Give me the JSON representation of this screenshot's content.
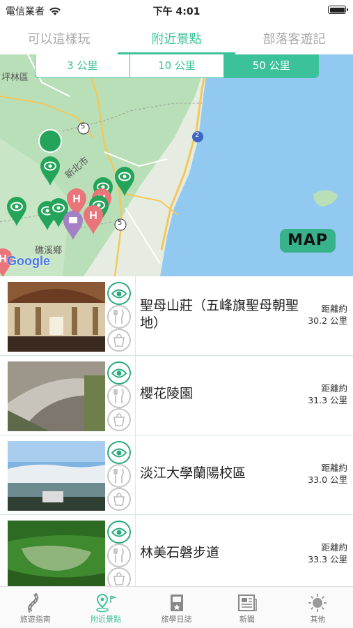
{
  "status": {
    "carrier": "電信業者",
    "time": "下午 4:01"
  },
  "tabs": [
    {
      "label": "可以這樣玩",
      "active": false
    },
    {
      "label": "附近景點",
      "active": true
    },
    {
      "label": "部落客遊記",
      "active": false
    }
  ],
  "distance_filter": {
    "options": [
      "3 公里",
      "10 公里",
      "50 公里"
    ],
    "selected": "50 公里"
  },
  "map": {
    "labels": {
      "pinglin": "坪林區",
      "xinbei": "新北市",
      "jiaoxi": "礁溪鄉",
      "route5a": "5",
      "route5b": "5",
      "route2": "2",
      "google": "Google"
    },
    "map_button": "MAP"
  },
  "attractions": [
    {
      "name": "聖母山莊（五峰旗聖母朝聖地）",
      "distance_label": "距離約",
      "distance": "30.2 公里"
    },
    {
      "name": "櫻花陵園",
      "distance_label": "距離約",
      "distance": "31.3 公里"
    },
    {
      "name": "淡江大學蘭陽校區",
      "distance_label": "距離約",
      "distance": "33.0 公里"
    },
    {
      "name": "林美石磐步道",
      "distance_label": "距離約",
      "distance": "33.3 公里"
    }
  ],
  "bottom_nav": [
    {
      "label": "旅遊指南",
      "icon": "road-icon",
      "active": false
    },
    {
      "label": "附近景點",
      "icon": "nearby-pin-icon",
      "active": true
    },
    {
      "label": "旅學日誌",
      "icon": "journal-icon",
      "active": false
    },
    {
      "label": "新聞",
      "icon": "news-icon",
      "active": false
    },
    {
      "label": "其他",
      "icon": "sun-icon",
      "active": false
    }
  ],
  "colors": {
    "accent": "#3cc29a",
    "sea": "#92c9f1",
    "land": "#e8ede4"
  }
}
